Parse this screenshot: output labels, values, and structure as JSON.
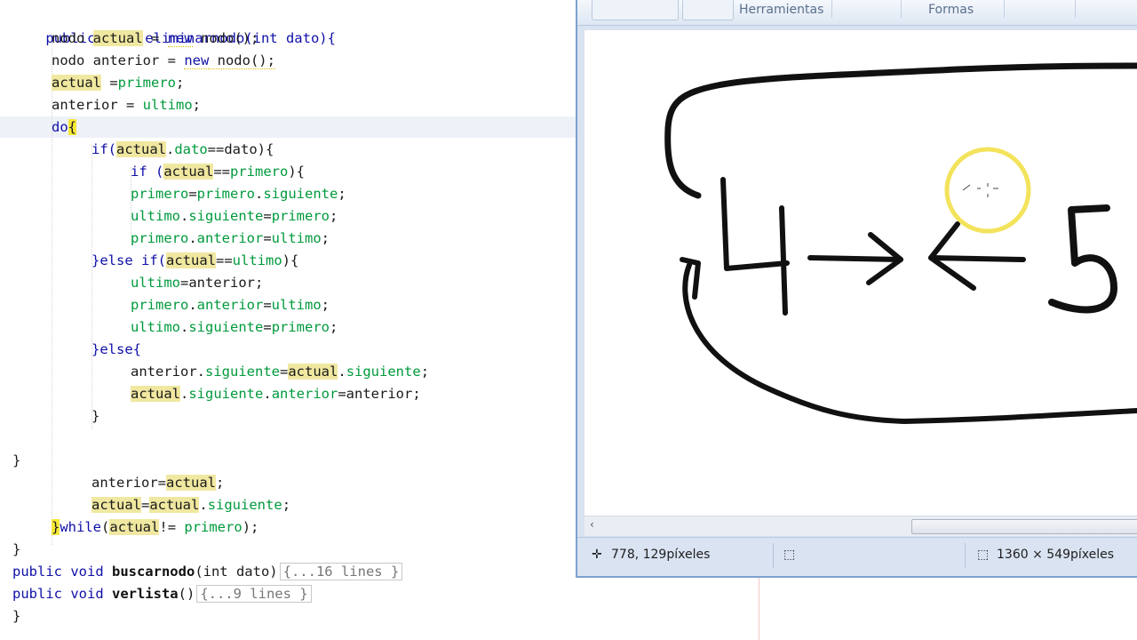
{
  "editor": {
    "lines": {
      "l0": "public void eliminarnodo(int dato){",
      "l1a": "nodo ",
      "l1b": "actual",
      "l1c": " = ",
      "l1d": "new",
      "l1e": " nodo();",
      "l2a": "nodo anterior = ",
      "l2b": "new",
      "l2c": " nodo();",
      "l3a": "actual",
      "l3b": " =",
      "l3c": "primero",
      "l3d": ";",
      "l4a": "anterior = ",
      "l4b": "ultimo",
      "l4c": ";",
      "l5a": "do",
      "l5b": "{",
      "l6a": "if(",
      "l6b": "actual",
      "l6c": ".",
      "l6d": "dato",
      "l6e": "==dato){",
      "l7a": "if (",
      "l7b": "actual",
      "l7c": "==",
      "l7d": "primero",
      "l7e": "){",
      "l8a": "primero",
      "l8b": "=",
      "l8c": "primero",
      "l8d": ".",
      "l8e": "siguiente",
      "l8f": ";",
      "l9a": "ultimo",
      "l9b": ".",
      "l9c": "siguiente",
      "l9d": "=",
      "l9e": "primero",
      "l9f": ";",
      "l10a": "primero",
      "l10b": ".",
      "l10c": "anterior",
      "l10d": "=",
      "l10e": "ultimo",
      "l10f": ";",
      "l11a": "}else if(",
      "l11b": "actual",
      "l11c": "==",
      "l11d": "ultimo",
      "l11e": "){",
      "l12a": "ultimo",
      "l12b": "=anterior;",
      "l13a": "primero",
      "l13b": ".",
      "l13c": "anterior",
      "l13d": "=",
      "l13e": "ultimo",
      "l13f": ";",
      "l14a": "ultimo",
      "l14b": ".",
      "l14c": "siguiente",
      "l14d": "=",
      "l14e": "primero",
      "l14f": ";",
      "l15": "}else{",
      "l16a": "anterior.",
      "l16b": "siguiente",
      "l16c": "=",
      "l16d": "actual",
      "l16e": ".",
      "l16f": "siguiente",
      "l16g": ";",
      "l17a": "actual",
      "l17b": ".",
      "l17c": "siguiente",
      "l17d": ".",
      "l17e": "anterior",
      "l17f": "=anterior;",
      "l18": "}",
      "l19": "}",
      "l20a": "anterior=",
      "l20b": "actual",
      "l20c": ";",
      "l21a": "actual",
      "l21b": "=",
      "l21c": "actual",
      "l21d": ".",
      "l21e": "siguiente",
      "l21f": ";",
      "l22a": "}",
      "l22b": "while",
      "l22c": "(",
      "l22d": "actual",
      "l22e": "!= ",
      "l22f": "primero",
      "l22g": ");",
      "l23": "}",
      "l24a": "public void ",
      "l24b": "buscarnodo",
      "l24c": "(int dato)",
      "l24d": "{...16 lines }",
      "l25a": "public void ",
      "l25b": "verlista",
      "l25c": "()",
      "l25d": "{...9 lines }",
      "l26": "}"
    }
  },
  "paint": {
    "ribbon": {
      "group_tools": "Herramientas",
      "group_shapes": "Formas"
    },
    "canvas": {
      "drawing_text": "4→←5",
      "cursor_highlight_color": "#f2e04a"
    },
    "status": {
      "cursor_position": "778, 129píxeles",
      "image_size": "1360 × 549píxeles"
    }
  },
  "colors": {
    "keyword": "#1010a8",
    "field": "#009a3c",
    "highlight": "#f0e8a0",
    "window_frame": "#7da2ce"
  }
}
